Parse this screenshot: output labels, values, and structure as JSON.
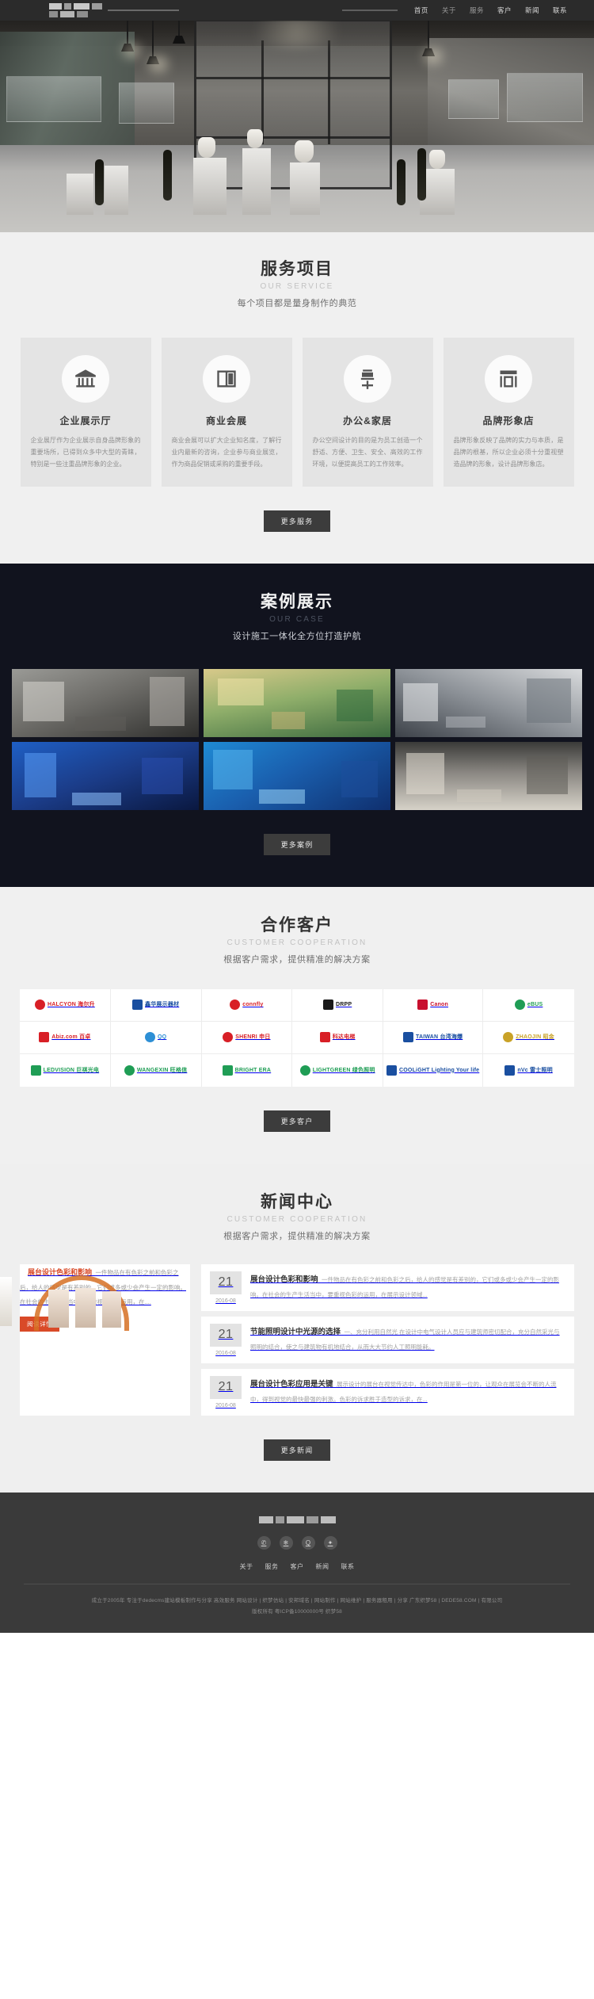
{
  "header": {
    "logo_alt": "企业标识",
    "nav": [
      {
        "label": "首页",
        "dim": false
      },
      {
        "label": "关于",
        "dim": true
      },
      {
        "label": "服务",
        "dim": true
      },
      {
        "label": "客户",
        "dim": false
      },
      {
        "label": "新闻",
        "dim": false
      },
      {
        "label": "联系",
        "dim": false
      }
    ]
  },
  "hero": {
    "alt": "展厅室内效果图"
  },
  "service": {
    "title": "服务项目",
    "en": "OUR SERVICE",
    "sub": "每个项目都是量身制作的典范",
    "more": "更多服务",
    "cards": [
      {
        "icon": "museum-icon",
        "name": "企业展示厅",
        "desc": "企业展厅作为企业展示自身品牌形象的重要场所，已得到众多中大型的青睐，特别是一些注重品牌形象的企业。"
      },
      {
        "icon": "exhibition-board-icon",
        "name": "商业会展",
        "desc": "商业会展可以扩大企业知名度，了解行业内最新的咨询，企业参与商业展览，作为商品促销或采购的重要手段。"
      },
      {
        "icon": "office-chair-icon",
        "name": "办公&家居",
        "desc": "办公空间设计的目的是为员工创造一个舒适、方便、卫生、安全、高效的工作环境，以便提高员工的工作效率。"
      },
      {
        "icon": "storefront-icon",
        "name": "品牌形象店",
        "desc": "品牌形象反映了品牌的实力与本质，是品牌的根基，所以企业必须十分重视塑造品牌的形象，设计品牌形象店。"
      }
    ]
  },
  "cases": {
    "title": "案例展示",
    "en": "OUR CASE",
    "sub": "设计施工一体化全方位打造护航",
    "more": "更多案例",
    "items": [
      {
        "alt": "白色展厅案例"
      },
      {
        "alt": "暖色客厅案例"
      },
      {
        "alt": "灰白展示空间案例"
      },
      {
        "alt": "蓝色科技展厅案例"
      },
      {
        "alt": "蓝色主题展台案例"
      },
      {
        "alt": "商业展位案例"
      }
    ]
  },
  "customers": {
    "title": "合作客户",
    "en": "CUSTOMER COOPERATION",
    "sub": "根据客户需求，提供精准的解决方案",
    "more": "更多客户",
    "logos": [
      {
        "name": "HALCYON 海尔升",
        "color": "#d81f26",
        "shape": "circle"
      },
      {
        "name": "鑫华展示器材",
        "color": "#1a4fa0",
        "shape": "square"
      },
      {
        "name": "connfly",
        "color": "#d81f26",
        "shape": "circle"
      },
      {
        "name": "DRPP",
        "color": "#1a1a1a",
        "shape": "square"
      },
      {
        "name": "Canon",
        "color": "#c8102e",
        "shape": "square"
      },
      {
        "name": "eBUS",
        "color": "#1f9d55",
        "shape": "circle"
      },
      {
        "name": "Abiz.com 百卓",
        "color": "#d81f26",
        "shape": "square"
      },
      {
        "name": "QQ",
        "color": "#2d8fd5",
        "shape": "circle"
      },
      {
        "name": "SHENRI 申日",
        "color": "#d81f26",
        "shape": "circle"
      },
      {
        "name": "科达电梯",
        "color": "#d81f26",
        "shape": "square"
      },
      {
        "name": "TAIWAN 台湾海爆",
        "color": "#1a4fa0",
        "shape": "square"
      },
      {
        "name": "ZHAOJIN 昭金",
        "color": "#c9a227",
        "shape": "circle"
      },
      {
        "name": "LEDVISION 巨祺光电",
        "color": "#1f9d55",
        "shape": "square"
      },
      {
        "name": "WANGEXIN 旺格信",
        "color": "#1f9d55",
        "shape": "circle"
      },
      {
        "name": "BRIGHT ERA",
        "color": "#1f9d55",
        "shape": "square"
      },
      {
        "name": "LIGHTGREEN 绿色照明",
        "color": "#1f9d55",
        "shape": "circle"
      },
      {
        "name": "COOLiGHT Lighting Your life",
        "color": "#1a4fa0",
        "shape": "square"
      },
      {
        "name": "nVc 雷士照明",
        "color": "#1a4fa0",
        "shape": "square"
      }
    ]
  },
  "news": {
    "title": "新闻中心",
    "en": "CUSTOMER COOPERATION",
    "sub": "根据客户需求，提供精准的解决方案",
    "more": "更多新闻",
    "feature": {
      "alt": "展台设计色彩案例图",
      "title": "展台设计色彩和影响",
      "desc": "一件物品在有色彩之前和色彩之后，给人的感觉是有差别的，它们或多或少会产生一定的影响。在社会的生产生活当中，要重视色彩的运用，在....",
      "read_more": "阅读详情"
    },
    "items": [
      {
        "day": "21",
        "month": "2016-08",
        "title": "展台设计色彩和影响",
        "desc": "一件物品在有色彩之前和色彩之后，给人的感觉是有差别的，它们或多或少会产生一定的影响。在社会的生产生活当中，要重视色彩的运用，在展示设计领域..."
      },
      {
        "day": "21",
        "month": "2016-08",
        "title": "节能照明设计中光源的选择",
        "desc": "一、充分利用自然光 在设计中电气设计人员应与建筑师密切配合，充分自然采光与照明的结合，使之与建筑物有机地结合，从而大大节约人工照明能耗。"
      },
      {
        "day": "21",
        "month": "2016-08",
        "title": "展台设计色彩应用是关键",
        "desc": "展示设计的展台在视觉传达中，色彩的作用是第一位的，让观众在展览会不断的人流中，得到视觉的最快最强的刺激。色彩的诉求胜于造型的诉求，在..."
      }
    ]
  },
  "footer": {
    "nav": [
      "关于",
      "服务",
      "客户",
      "新闻",
      "联系"
    ],
    "social": [
      {
        "icon": "wechat-icon",
        "glyph": "✆"
      },
      {
        "icon": "weibo-icon",
        "glyph": "❄"
      },
      {
        "icon": "qq-icon",
        "glyph": "Q"
      },
      {
        "icon": "link-icon",
        "glyph": "✦"
      }
    ],
    "copyright_line1": "成立于2005年  专注于dedecms建站模板制作与分享 高效服务    网站设计 | 织梦仿站 | 安邦域名 | 网站制作 | 网站维护 | 服务器租用 | 分享    广东织梦58 | DEDE58.COM | 有限公司",
    "copyright_line2": "版权所有 粤ICP备10000000号 织梦58"
  }
}
